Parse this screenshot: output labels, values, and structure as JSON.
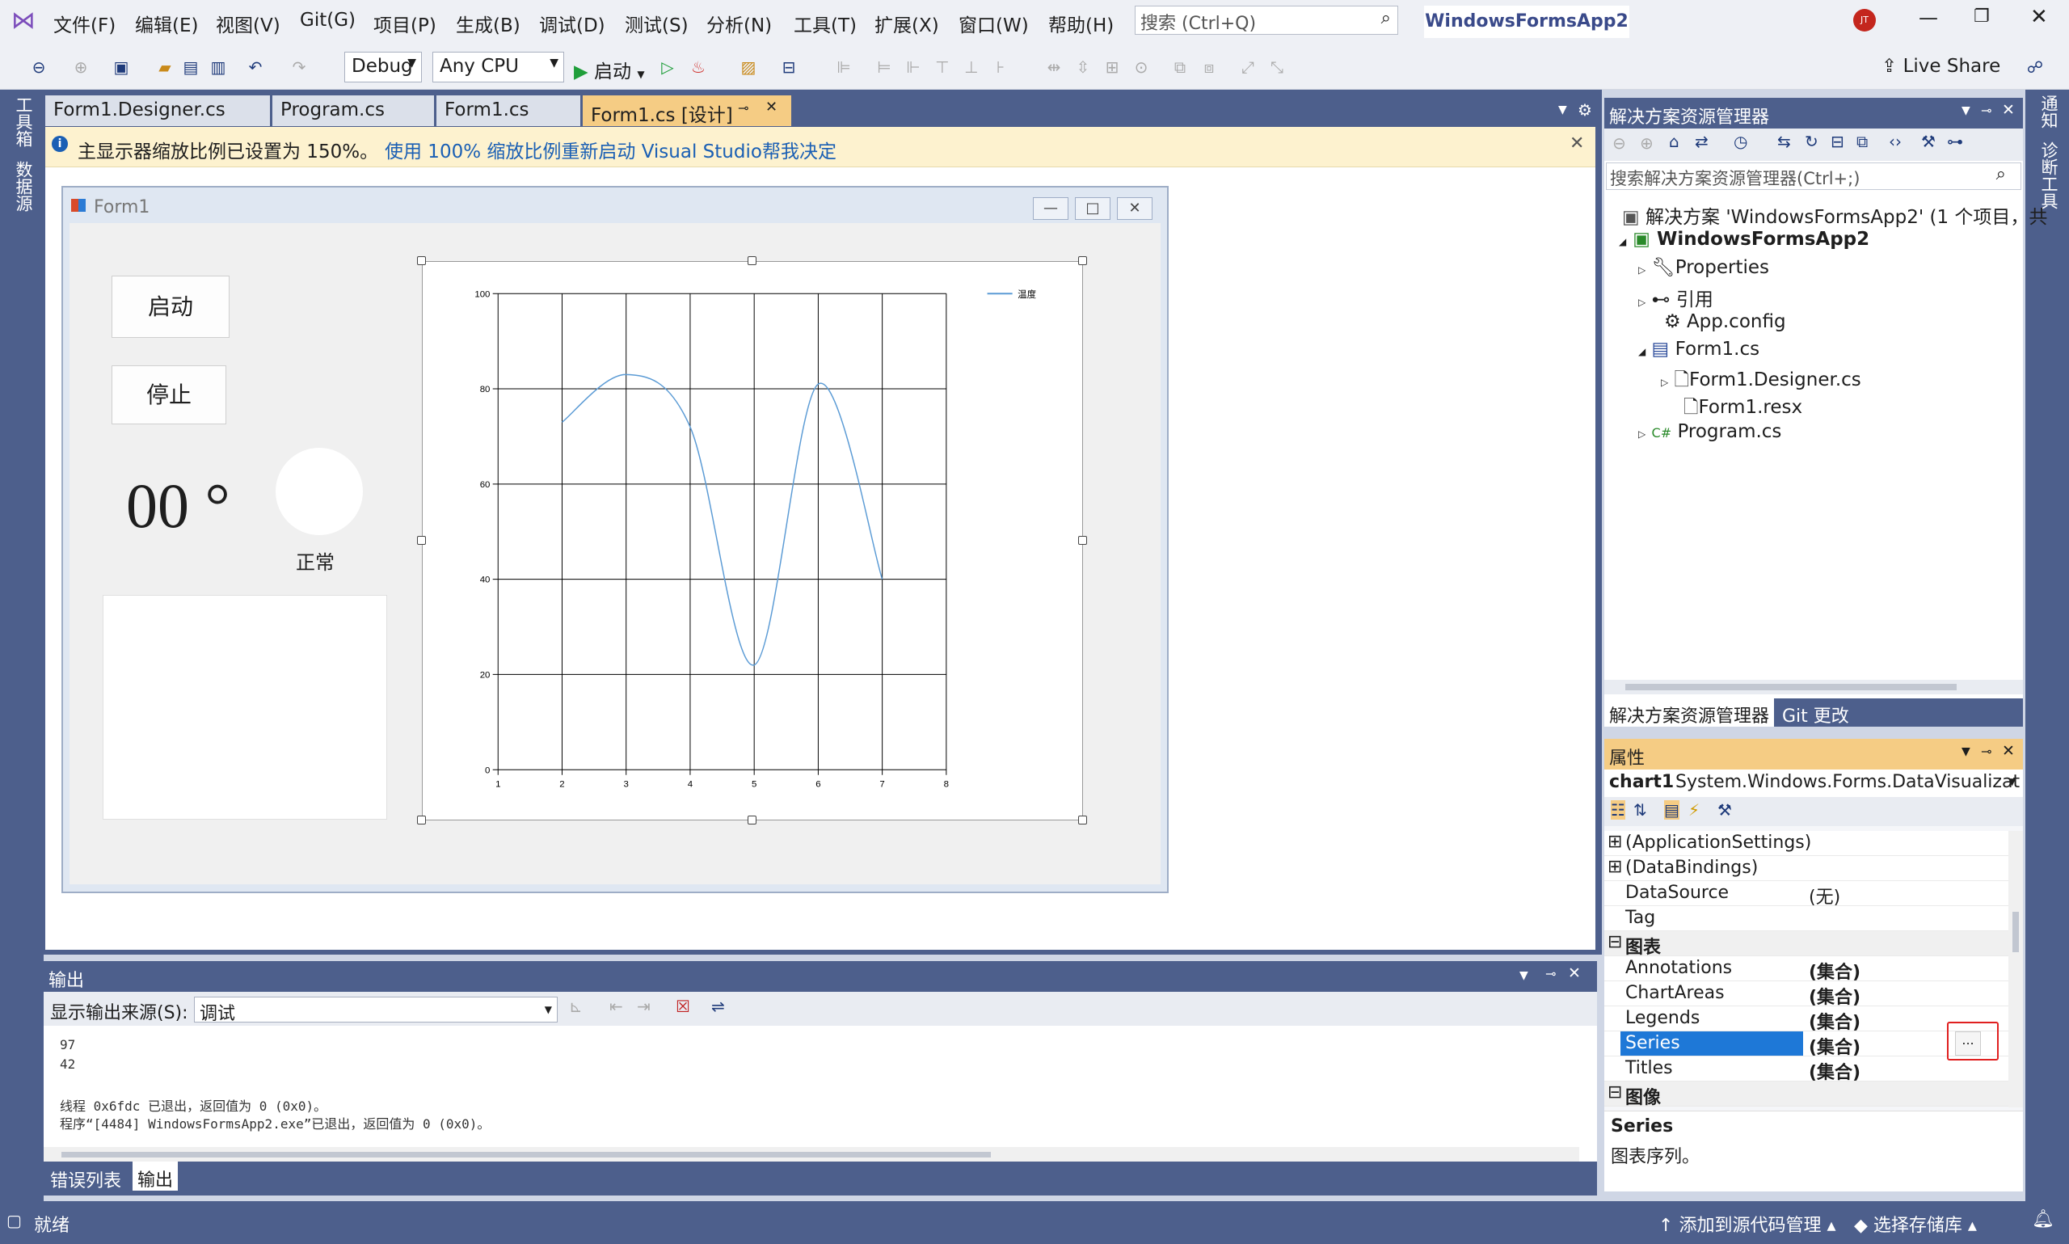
{
  "menu": {
    "items": [
      "文件(F)",
      "编辑(E)",
      "视图(V)",
      "Git(G)",
      "项目(P)",
      "生成(B)",
      "调试(D)",
      "测试(S)",
      "分析(N)",
      "工具(T)",
      "扩展(X)",
      "窗口(W)",
      "帮助(H)"
    ],
    "search_placeholder": "搜索 (Ctrl+Q)",
    "solution_name": "WindowsFormsApp2",
    "avatar": "JT"
  },
  "toolbar": {
    "config": "Debug",
    "platform": "Any CPU",
    "start_label": "启动",
    "live_share": "Live Share"
  },
  "left_strip": {
    "toolbox": "工具箱",
    "datasources": "数据源"
  },
  "right_strip": {
    "notifications": "通知",
    "diag": "诊断工具"
  },
  "tabs": [
    {
      "label": "Form1.Designer.cs"
    },
    {
      "label": "Program.cs"
    },
    {
      "label": "Form1.cs"
    },
    {
      "label": "Form1.cs [设计]"
    }
  ],
  "infobar": {
    "message": "主显示器缩放比例已设置为 150%。",
    "restart_link": "使用 100% 缩放比例重新启动 Visual Studio",
    "help_link": "帮我决定"
  },
  "form": {
    "title": "Form1",
    "start_button": "启动",
    "stop_button": "停止",
    "temp_value": "00 °",
    "status_label": "正常"
  },
  "chart_data": {
    "type": "line",
    "x": [
      2,
      3,
      4,
      5,
      6,
      7
    ],
    "series": [
      {
        "name": "温度",
        "values": [
          73,
          83,
          72,
          22,
          81,
          40
        ]
      }
    ],
    "xlim": [
      1,
      8
    ],
    "ylim": [
      0,
      100
    ],
    "xticks": [
      "1",
      "2",
      "3",
      "4",
      "5",
      "6",
      "7",
      "8"
    ],
    "yticks": [
      "0",
      "20",
      "40",
      "60",
      "80",
      "100"
    ],
    "grid": true,
    "legend": "top-right",
    "color": "#5b9bd5"
  },
  "solution_explorer": {
    "title": "解决方案资源管理器",
    "search_placeholder": "搜索解决方案资源管理器(Ctrl+;)",
    "items": [
      {
        "label": "解决方案 'WindowsFormsApp2' (1 个项目，共"
      },
      {
        "label": "WindowsFormsApp2"
      },
      {
        "label": "Properties"
      },
      {
        "label": "引用"
      },
      {
        "label": "App.config"
      },
      {
        "label": "Form1.cs"
      },
      {
        "label": "Form1.Designer.cs"
      },
      {
        "label": "Form1.resx"
      },
      {
        "label": "Program.cs"
      }
    ],
    "bottom_tabs": [
      "解决方案资源管理器",
      "Git 更改"
    ]
  },
  "properties": {
    "title": "属性",
    "object_name": "chart1",
    "object_type": "System.Windows.Forms.DataVisualizat",
    "rows": [
      {
        "name": "(ApplicationSettings)",
        "value": ""
      },
      {
        "name": "(DataBindings)",
        "value": ""
      },
      {
        "name": "DataSource",
        "value": "(无)"
      },
      {
        "name": "Tag",
        "value": ""
      },
      {
        "name": "图表",
        "value": ""
      },
      {
        "name": "Annotations",
        "value": "(集合)"
      },
      {
        "name": "ChartAreas",
        "value": "(集合)"
      },
      {
        "name": "Legends",
        "value": "(集合)"
      },
      {
        "name": "Series",
        "value": "(集合)"
      },
      {
        "name": "Titles",
        "value": "(集合)"
      },
      {
        "name": "图像",
        "value": ""
      }
    ],
    "ellipsis": "...",
    "desc_title": "Series",
    "desc_text": "图表序列。"
  },
  "output": {
    "title": "输出",
    "source_label": "显示输出来源(S):",
    "source_value": "调试",
    "lines": [
      "97",
      "42",
      "",
      "线程 0x6fdc 已退出，返回值为 0 (0x0)。",
      "程序“[4484] WindowsFormsApp2.exe”已退出，返回值为 0 (0x0)。"
    ]
  },
  "bottom_tabs": [
    "错误列表",
    "输出"
  ],
  "status": {
    "ready": "就绪",
    "add_source": "添加到源代码管理",
    "select_repo": "选择存储库"
  }
}
